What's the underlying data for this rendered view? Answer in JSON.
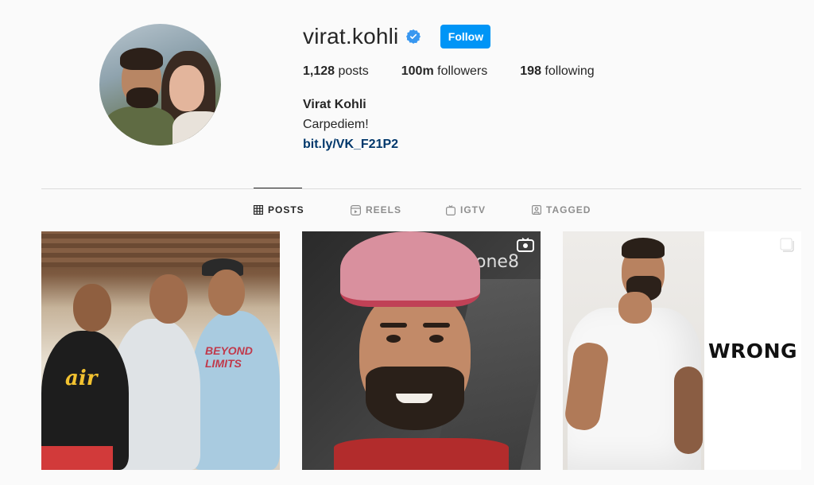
{
  "profile": {
    "username": "virat.kohli",
    "verified": true,
    "follow_label": "Follow",
    "posts_count": "1,128",
    "posts_label": "posts",
    "followers_count": "100m",
    "followers_label": "followers",
    "following_count": "198",
    "following_label": "following",
    "full_name": "Virat Kohli",
    "bio": "Carpediem!",
    "link": "bit.ly/VK_F21P2"
  },
  "tabs": [
    {
      "label": "POSTS",
      "icon": "grid-icon",
      "active": true
    },
    {
      "label": "REELS",
      "icon": "reels-icon",
      "active": false
    },
    {
      "label": "IGTV",
      "icon": "igtv-icon",
      "active": false
    },
    {
      "label": "TAGGED",
      "icon": "tagged-icon",
      "active": false
    }
  ],
  "posts": [
    {
      "overlay_text": "air",
      "shirt_text": "BEYOND LIMITS"
    },
    {
      "brand_text": "one8",
      "badge_icon": "igtv-icon"
    },
    {
      "brand_text": "WRONG",
      "badge_icon": "multi-photo-icon"
    }
  ],
  "colors": {
    "accent": "#0095f6",
    "verified": "#3897f0",
    "link": "#00376b",
    "background": "#fafafa",
    "divider": "#dbdbdb"
  }
}
